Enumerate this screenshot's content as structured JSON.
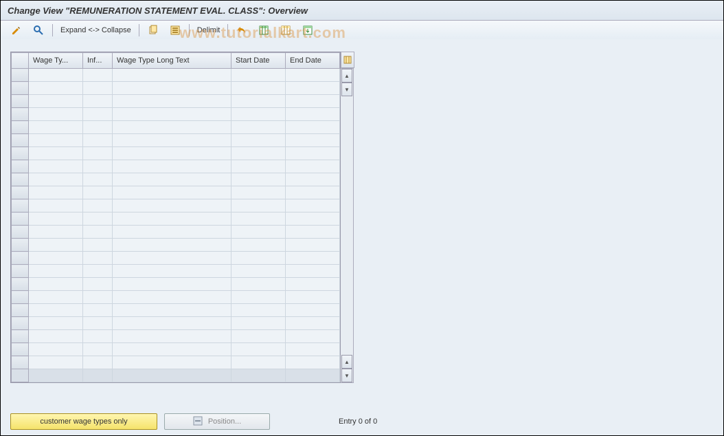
{
  "title": "Change View \"REMUNERATION STATEMENT EVAL. CLASS\": Overview",
  "toolbar": {
    "expand_collapse": "Expand <-> Collapse",
    "delimit": "Delimit"
  },
  "grid": {
    "columns": {
      "sel": "",
      "wage_type": "Wage Ty...",
      "inf": "Inf...",
      "long_text": "Wage Type Long Text",
      "start_date": "Start Date",
      "end_date": "End Date"
    },
    "row_count": 24
  },
  "footer": {
    "customer_btn": "customer wage types only",
    "position_btn": "Position...",
    "entry_text": "Entry 0 of 0"
  },
  "watermark": "www.tutorialkart.com",
  "icons": {
    "pencil_glasses": "toggle-display-change",
    "find": "find-icon",
    "copy": "copy-icon",
    "select_all": "select-all-icon",
    "undo": "undo-icon",
    "table_settings": "table-settings-icon",
    "print": "print-icon",
    "export": "export-icon",
    "grid_config": "grid-config-icon",
    "position": "position-icon"
  }
}
